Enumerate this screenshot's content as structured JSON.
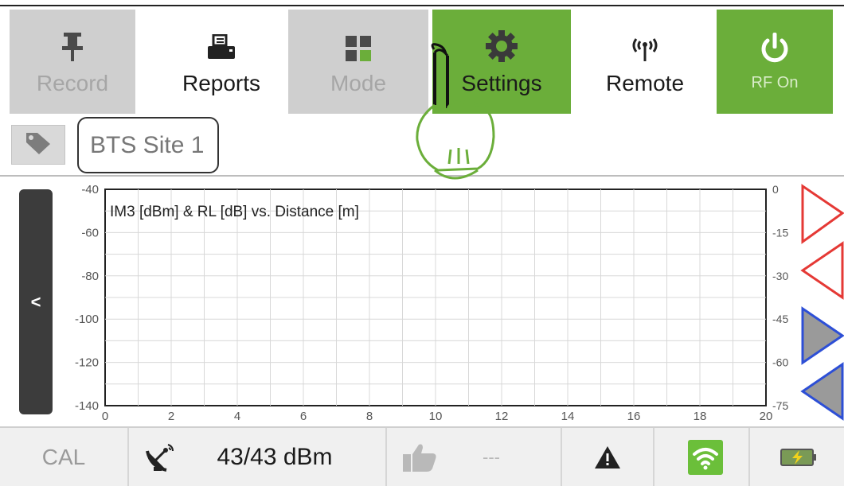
{
  "toolbar": {
    "items": [
      {
        "label": "Record",
        "icon": "pin-icon",
        "state": "disabled"
      },
      {
        "label": "Reports",
        "icon": "printer-icon",
        "state": "normal"
      },
      {
        "label": "Mode",
        "icon": "grid-icon",
        "state": "disabled"
      },
      {
        "label": "Settings",
        "icon": "gear-icon",
        "state": "active"
      },
      {
        "label": "Remote",
        "icon": "antenna-icon",
        "state": "normal"
      },
      {
        "label": "RF On",
        "icon": "power-icon",
        "state": "active"
      }
    ],
    "colors": {
      "active": "#6bae3a",
      "disabled": "#cfcfcf"
    }
  },
  "tag": {
    "site_name": "BTS Site 1",
    "icon": "tag-icon"
  },
  "side_handle": {
    "glyph": "<"
  },
  "chart_data": {
    "type": "line",
    "title": "IM3 [dBm] & RL [dB] vs. Distance [m]",
    "xlabel": "",
    "ylabel": "",
    "xlim": [
      0,
      20
    ],
    "x_ticks": [
      "0",
      "2",
      "4",
      "6",
      "8",
      "10",
      "12",
      "14",
      "16",
      "18",
      "20"
    ],
    "ylim_left": [
      -140,
      -40
    ],
    "y_left_ticks": [
      "-40",
      "-60",
      "-80",
      "-100",
      "-120",
      "-140"
    ],
    "ylim_right": [
      -75,
      0
    ],
    "y_right_ticks": [
      "0",
      "-15",
      "-30",
      "-45",
      "-60",
      "-75"
    ],
    "grid": true,
    "series": []
  },
  "markers": [
    {
      "shape": "triangle-right",
      "color": "#e53935"
    },
    {
      "shape": "triangle-left",
      "color": "#e53935"
    },
    {
      "shape": "triangle-right",
      "color": "#2d4fd6"
    },
    {
      "shape": "triangle-left",
      "color": "#2d4fd6"
    }
  ],
  "status": {
    "cal_label": "CAL",
    "power_text": "43/43 dBm",
    "pim_result": "---",
    "icons": [
      "satellite-dish-icon",
      "thumbs-up-icon",
      "warning-icon",
      "wifi-icon",
      "battery-charging-icon"
    ]
  }
}
